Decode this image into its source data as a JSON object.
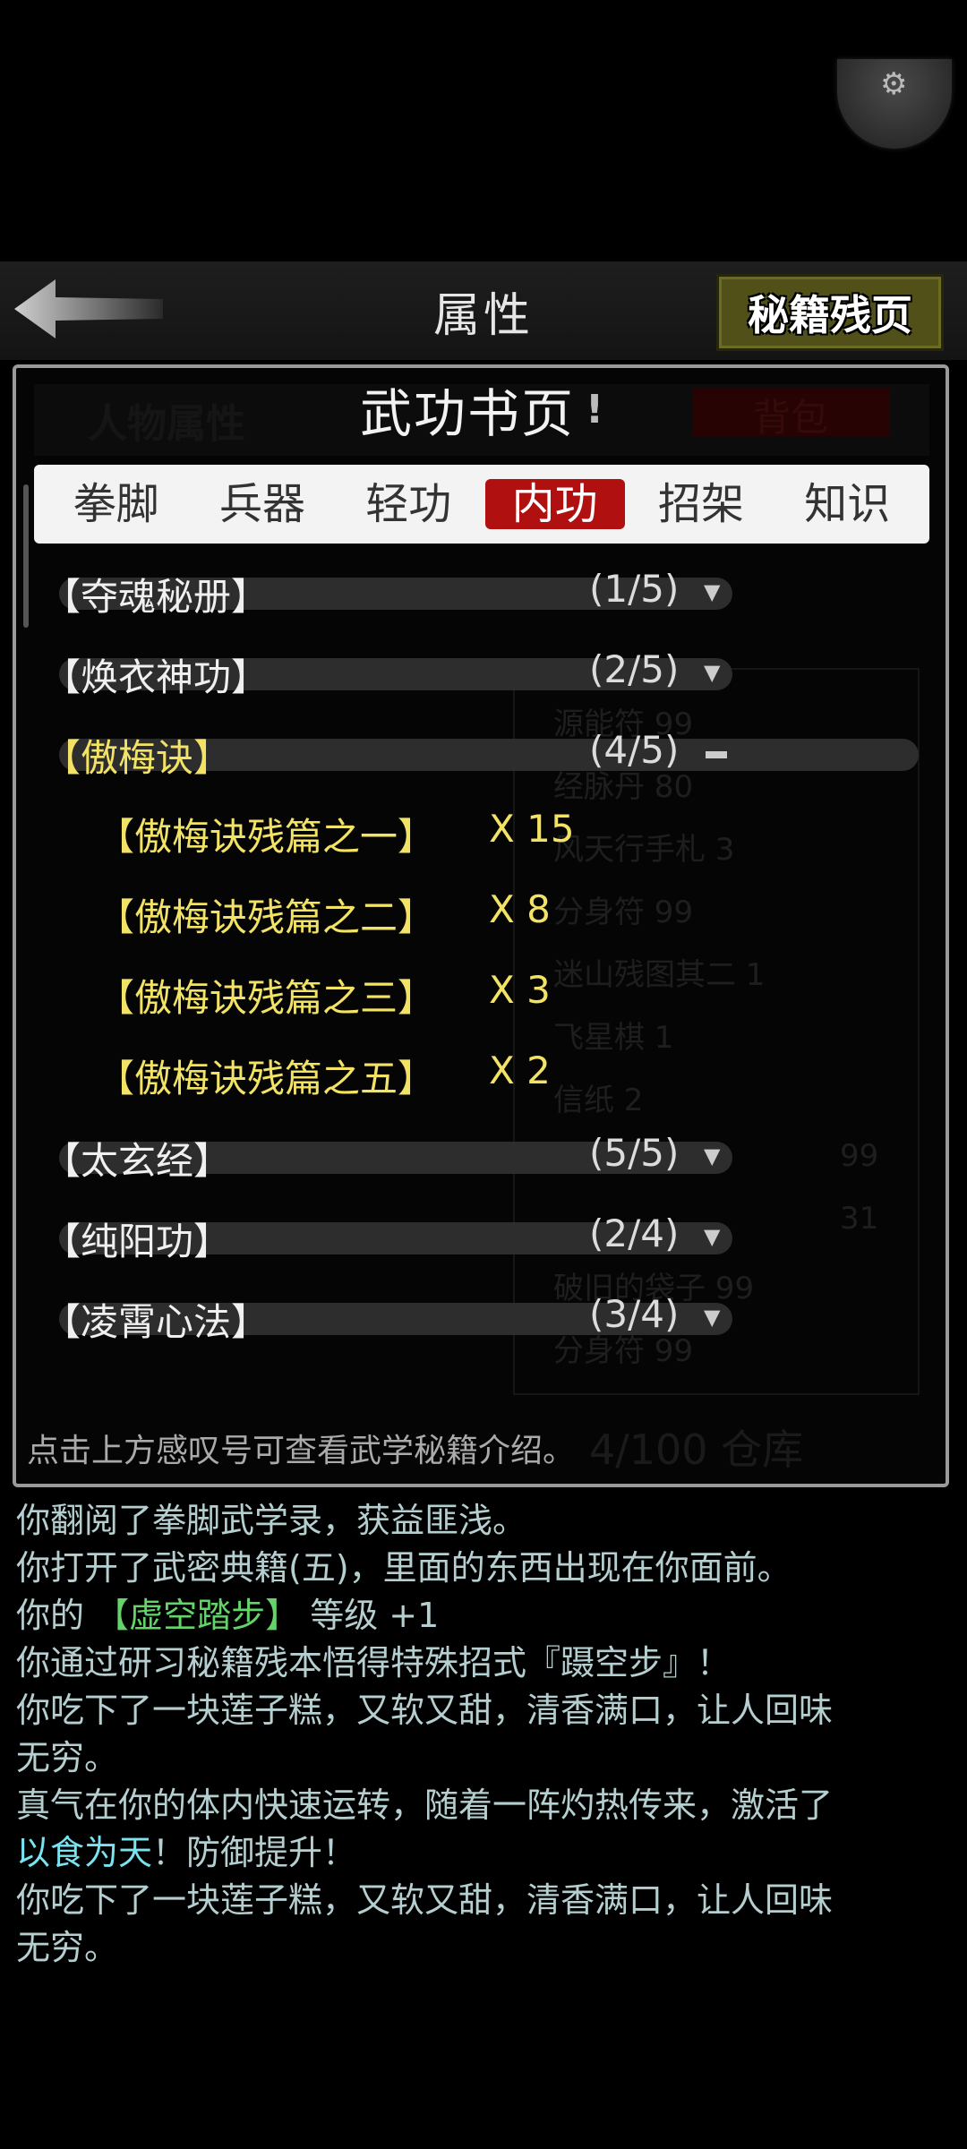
{
  "header": {
    "title": "属性",
    "right_button": "秘籍残页"
  },
  "background_panel": {
    "left_title": "人物属性",
    "right_button": "背包",
    "rows": [
      "源能符 99",
      "经脉丹 80",
      "风天行手札 3",
      "分身符 99",
      "迷山残图其二 1",
      "飞星棋 1",
      "信纸 2",
      "99",
      "31",
      "破旧的袋子 99",
      "分身符 99"
    ],
    "footer_text": "4/100 仓库"
  },
  "overlay": {
    "title": "武功书页",
    "info_mark": "!",
    "tabs": [
      "拳脚",
      "兵器",
      "轻功",
      "内功",
      "招架",
      "知识"
    ],
    "active_tab": "内功",
    "items": [
      {
        "name": "【夺魂秘册】",
        "count": "(1/5)"
      },
      {
        "name": "【焕衣神功】",
        "count": "(2/5)"
      },
      {
        "name": "【傲梅诀】",
        "count": "(4/5)",
        "expanded": true,
        "pages": [
          {
            "name": "【傲梅诀残篇之一】",
            "qty": "X 15"
          },
          {
            "name": "【傲梅诀残篇之二】",
            "qty": "X 8"
          },
          {
            "name": "【傲梅诀残篇之三】",
            "qty": "X 3"
          },
          {
            "name": "【傲梅诀残篇之五】",
            "qty": "X 2"
          }
        ]
      },
      {
        "name": "【太玄经】",
        "count": "(5/5)"
      },
      {
        "name": "【纯阳功】",
        "count": "(2/4)"
      },
      {
        "name": "【凌霄心法】",
        "count": "(3/4)"
      }
    ],
    "hint": "点击上方感叹号可查看武学秘籍介绍。"
  },
  "log": {
    "l1": "你翻阅了拳脚武学录，获益匪浅。",
    "l2": "你打开了武密典籍(五)，里面的东西出现在你面前。",
    "l3a": "你的 ",
    "l3b": "【虚空踏步】",
    "l3c": " 等级 +1",
    "l4": "你通过研习秘籍残本悟得特殊招式『蹑空步』！",
    "l5": "你吃下了一块莲子糕，又软又甜，清香满口，让人回味",
    "l6": "无穷。",
    "l7": "真气在你的体内快速运转，随着一阵灼热传来，激活了",
    "l8a": "以食为天",
    "l8b": "！防御提升！",
    "l9": "你吃下了一块莲子糕，又软又甜，清香满口，让人回味",
    "l10": "无穷。"
  },
  "colors": {
    "active_tab": "#b01010",
    "highlight_yellow": "#f2e265",
    "skill_green": "#63d36a",
    "buff_cyan": "#79e3f2",
    "log_text": "#b5cfd1"
  }
}
